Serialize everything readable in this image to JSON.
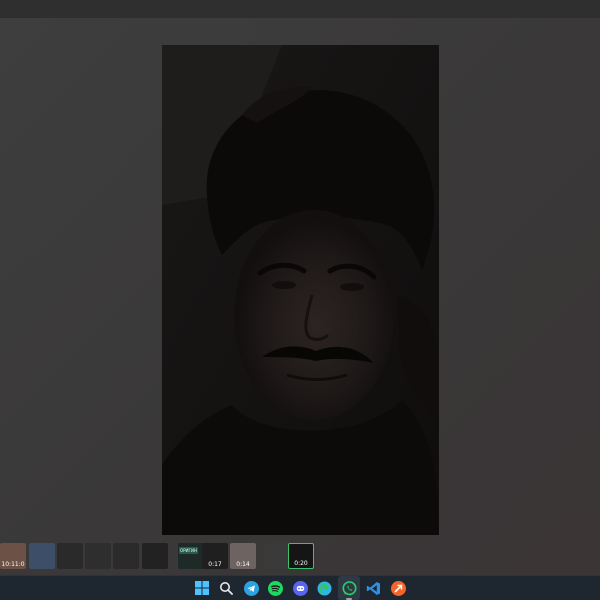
{
  "viewer": {
    "background_color": "#3b3b3b",
    "media_description_icon": "video-frame"
  },
  "thumbnails": [
    {
      "id": "t1",
      "duration": "10:11:0",
      "active": false,
      "color": "#6b5146"
    },
    {
      "id": "t2",
      "duration": "",
      "active": false,
      "color": "#3d4f68"
    },
    {
      "id": "t3",
      "duration": "",
      "active": false,
      "color": "#2a2a2a"
    },
    {
      "id": "t4",
      "duration": "",
      "active": false,
      "color": "#2e2e2e"
    },
    {
      "id": "t5",
      "duration": "",
      "active": false,
      "color": "#2b2b2b"
    },
    {
      "id": "t6",
      "duration": "",
      "active": false,
      "color": "#222222"
    },
    {
      "id": "t7",
      "duration": "",
      "active": false,
      "color": "#1e2a28",
      "tag": "ОРИГИН"
    },
    {
      "id": "t8",
      "duration": "0:17",
      "active": false,
      "color": "#1f1f1f"
    },
    {
      "id": "t9",
      "duration": "0:14",
      "active": false,
      "color": "#6d6360"
    },
    {
      "id": "t10",
      "duration": "",
      "active": false,
      "color": "#3a3a3a"
    },
    {
      "id": "t11",
      "duration": "0:20",
      "active": true,
      "color": "#151515"
    }
  ],
  "taskbar": {
    "icons": [
      {
        "name": "windows-start-icon",
        "color": "#4cc2ff"
      },
      {
        "name": "search-icon",
        "color": "#e6e6e6"
      },
      {
        "name": "telegram-icon",
        "color": "#2aa3e0"
      },
      {
        "name": "spotify-icon",
        "color": "#1ed760"
      },
      {
        "name": "discord-icon",
        "color": "#5865f2"
      },
      {
        "name": "edge-icon",
        "color": "#2fb4e9"
      },
      {
        "name": "whatsapp-icon",
        "color": "#25d366"
      },
      {
        "name": "vscode-icon",
        "color": "#2f8fe0"
      },
      {
        "name": "app-orange-icon",
        "color": "#f0652f"
      }
    ],
    "active_icon": "whatsapp-icon"
  }
}
